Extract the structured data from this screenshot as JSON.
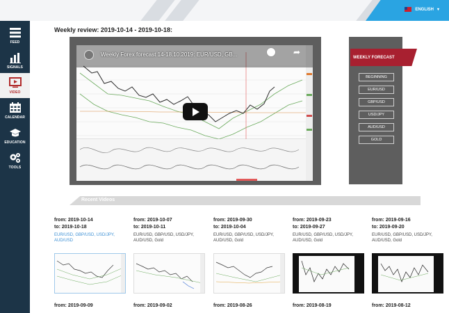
{
  "language": {
    "label": "ENGLISH"
  },
  "sidebar": {
    "items": [
      {
        "label": "FEED",
        "icon": "feed-icon"
      },
      {
        "label": "SIGNALS",
        "icon": "signals-icon"
      },
      {
        "label": "VIDEO",
        "icon": "video-icon",
        "active": true
      },
      {
        "label": "CALENDAR",
        "icon": "calendar-icon"
      },
      {
        "label": "EDUCATION",
        "icon": "education-icon"
      },
      {
        "label": "TOOLS",
        "icon": "tools-icon"
      }
    ]
  },
  "main": {
    "heading": "Weekly review: 2019-10-14 - 2019-10-18:",
    "video": {
      "title": "Weekly Forex forecast 14-18.10.2019: EUR/USD, GB..."
    },
    "forecast": {
      "title": "WEEKLY FORECAST",
      "buttons": [
        "BEGINNING",
        "EUR/USD",
        "GBP/USD",
        "USD/JPY",
        "AUD/USD",
        "GOLD"
      ]
    },
    "recent_label": "Recent Videos",
    "videos": [
      {
        "from": "from: 2019-10-14",
        "to": "to: 2019-10-18",
        "pairs": "EUR/USD, GBP/USD, USD/JPY, AUD/USD"
      },
      {
        "from": "from: 2019-10-07",
        "to": "to: 2019-10-11",
        "pairs": "EUR/USD, GBP/USD, USD/JPY, AUD/USD, Gold"
      },
      {
        "from": "from: 2019-09-30",
        "to": "to: 2019-10-04",
        "pairs": "EUR/USD, GBP/USD, USD/JPY, AUD/USD, Gold"
      },
      {
        "from": "from: 2019-09-23",
        "to": "to: 2019-09-27",
        "pairs": "EUR/USD, GBP/USD, USD/JPY, AUD/USD, Gold"
      },
      {
        "from": "from: 2019-09-16",
        "to": "to: 2019-09-20",
        "pairs": "EUR/USD, GBP/USD, USD/JPY, AUD/USD, Gold"
      }
    ],
    "videos_next": [
      {
        "from": "from: 2019-09-09"
      },
      {
        "from": "from: 2019-09-02"
      },
      {
        "from": "from: 2019-08-26"
      },
      {
        "from": "from: 2019-08-19"
      },
      {
        "from": "from: 2019-08-12"
      }
    ]
  },
  "colors": {
    "sidebar": "#1c3447",
    "accent": "#a82030",
    "language": "#2aa4e2",
    "link": "#3b8fd4"
  }
}
